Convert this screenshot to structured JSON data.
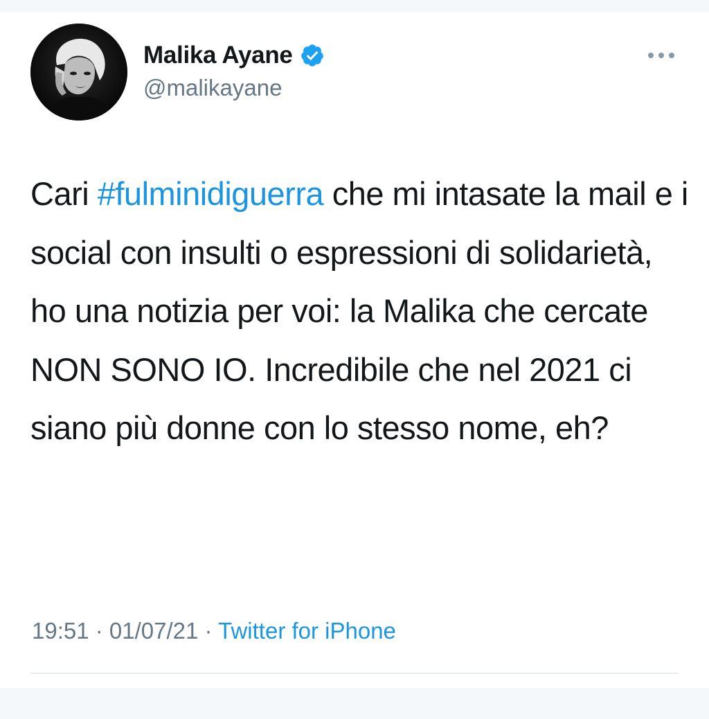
{
  "tweet": {
    "author": {
      "display_name": "Malika Ayane",
      "handle": "@malikayane",
      "verified": true,
      "avatar_icon": "profile-photo"
    },
    "more_icon": "more-horizontal-icon",
    "text": {
      "before_hashtag": "Cari ",
      "hashtag": "#fulminidiguerra",
      "after_hashtag": " che mi intasate la mail e i social con insulti o espressioni di solidarietà, ho una notizia per voi: la Malika che cercate NON SONO IO. Incredibile che nel 2021 ci siano più donne con lo stesso nome, eh?"
    },
    "meta": {
      "time": "19:51",
      "separator": " · ",
      "date": "01/07/21",
      "source": "Twitter for iPhone"
    }
  },
  "colors": {
    "link": "#1b95e0",
    "verified_badge": "#1da1f2",
    "secondary_text": "#657786",
    "primary_text": "#14171a",
    "background": "#f5f8fa"
  }
}
